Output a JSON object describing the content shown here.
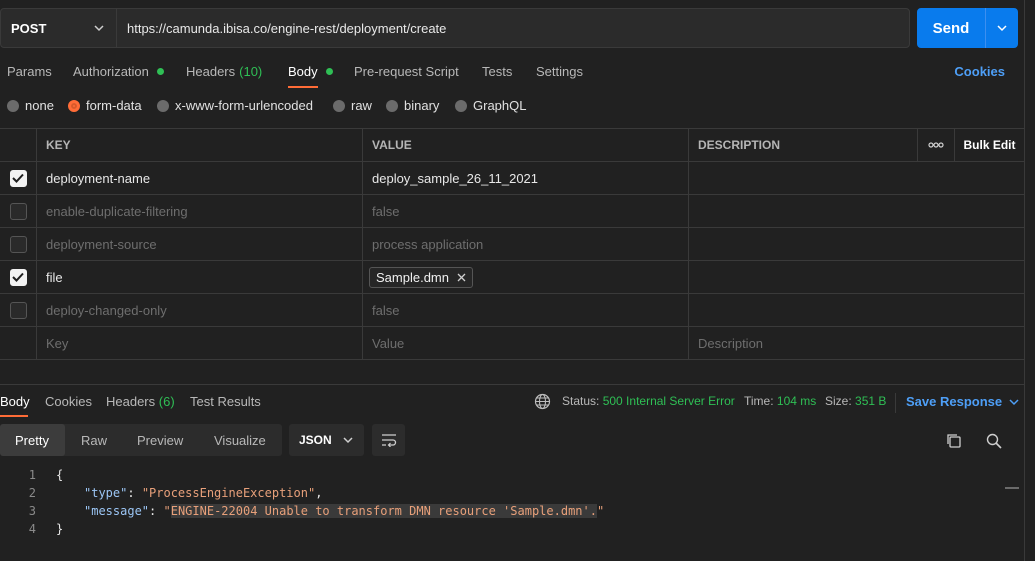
{
  "request": {
    "method": "POST",
    "url": "https://camunda.ibisa.co/engine-rest/deployment/create",
    "send_label": "Send"
  },
  "req_tabs": {
    "params": "Params",
    "authorization": "Authorization",
    "headers": "Headers",
    "headers_count": "(10)",
    "body": "Body",
    "prerequest": "Pre-request Script",
    "tests": "Tests",
    "settings": "Settings",
    "cookies": "Cookies"
  },
  "body_types": [
    "none",
    "form-data",
    "x-www-form-urlencoded",
    "raw",
    "binary",
    "GraphQL"
  ],
  "table": {
    "headers": {
      "key": "KEY",
      "value": "VALUE",
      "description": "DESCRIPTION",
      "more": "ooo",
      "bulk_edit": "Bulk Edit"
    },
    "rows": [
      {
        "checked": true,
        "key": "deployment-name",
        "value": "deploy_sample_26_11_2021"
      },
      {
        "checked": false,
        "key": "enable-duplicate-filtering",
        "value": "false"
      },
      {
        "checked": false,
        "key": "deployment-source",
        "value": "process application"
      },
      {
        "checked": true,
        "key": "file",
        "value": "Sample.dmn"
      },
      {
        "checked": false,
        "key": "deploy-changed-only",
        "value": "false"
      }
    ],
    "placeholder": {
      "key": "Key",
      "value": "Value",
      "description": "Description"
    }
  },
  "response": {
    "tabs": {
      "body": "Body",
      "cookies": "Cookies",
      "headers": "Headers",
      "headers_count": "(6)",
      "test_results": "Test Results"
    },
    "status_label": "Status:",
    "status_value": "500 Internal Server Error",
    "time_label": "Time:",
    "time_value": "104 ms",
    "size_label": "Size:",
    "size_value": "351 B",
    "save_label": "Save Response",
    "views": {
      "pretty": "Pretty",
      "raw": "Raw",
      "preview": "Preview",
      "visualize": "Visualize"
    },
    "format": "JSON",
    "code_lines": {
      "n1": "1",
      "n2": "2",
      "n3": "3",
      "n4": "4",
      "open": "{",
      "type_key": "\"type\"",
      "type_val": "\"ProcessEngineException\"",
      "message_key": "\"message\"",
      "message_val_open": "\"",
      "message_val_body": "ENGINE-22004 Unable to transform DMN resource 'Sample.dmn'.",
      "message_val_close": "\"",
      "close": "}"
    }
  }
}
